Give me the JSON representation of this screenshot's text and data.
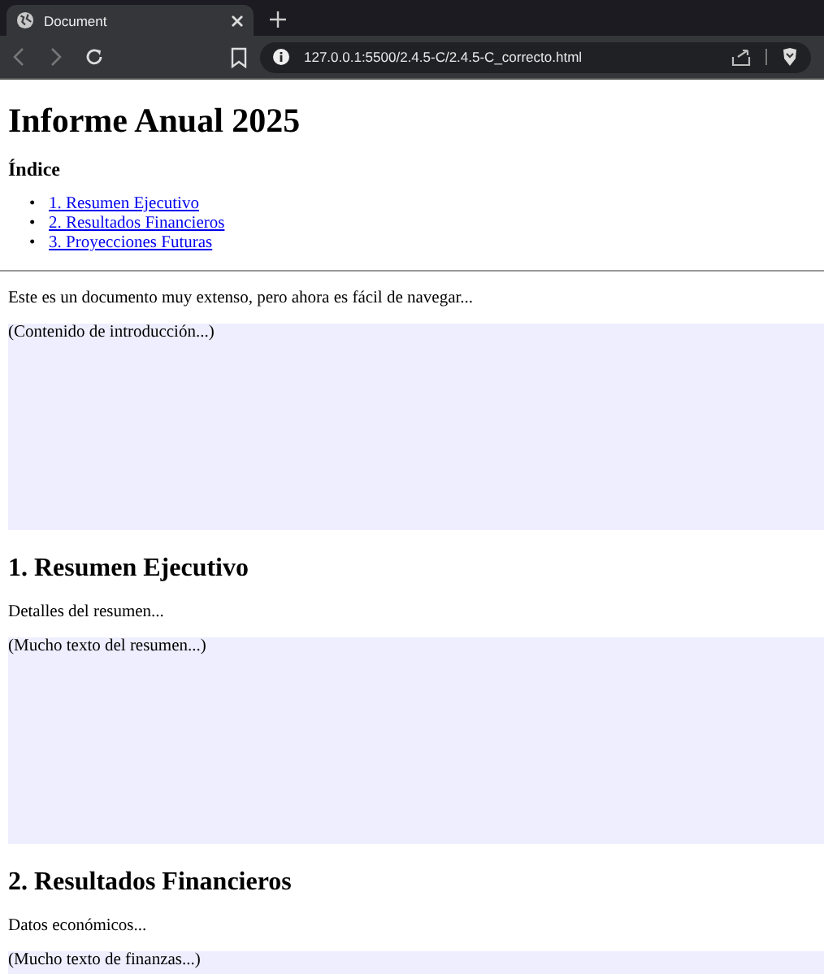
{
  "browser": {
    "tab_title": "Document",
    "url": "127.0.0.1:5500/2.4.5-C/2.4.5-C_correcto.html"
  },
  "page": {
    "title": "Informe Anual 2025",
    "index_title": "Índice",
    "index_links": [
      {
        "marker": "•",
        "label": "1. Resumen Ejecutivo"
      },
      {
        "marker": "•",
        "label": "2. Resultados Financieros"
      },
      {
        "marker": "•",
        "label": "3. Proyecciones Futuras"
      }
    ],
    "intro": "Este es un documento muy extenso, pero ahora es fácil de navegar...",
    "intro_box": "(Contenido de introducción...)",
    "sections": [
      {
        "heading": "1. Resumen Ejecutivo",
        "text": "Detalles del resumen...",
        "box_text": "(Mucho texto del resumen...)"
      },
      {
        "heading": "2. Resultados Financieros",
        "text": "Datos económicos...",
        "box_text": "(Mucho texto de finanzas...)"
      }
    ]
  }
}
